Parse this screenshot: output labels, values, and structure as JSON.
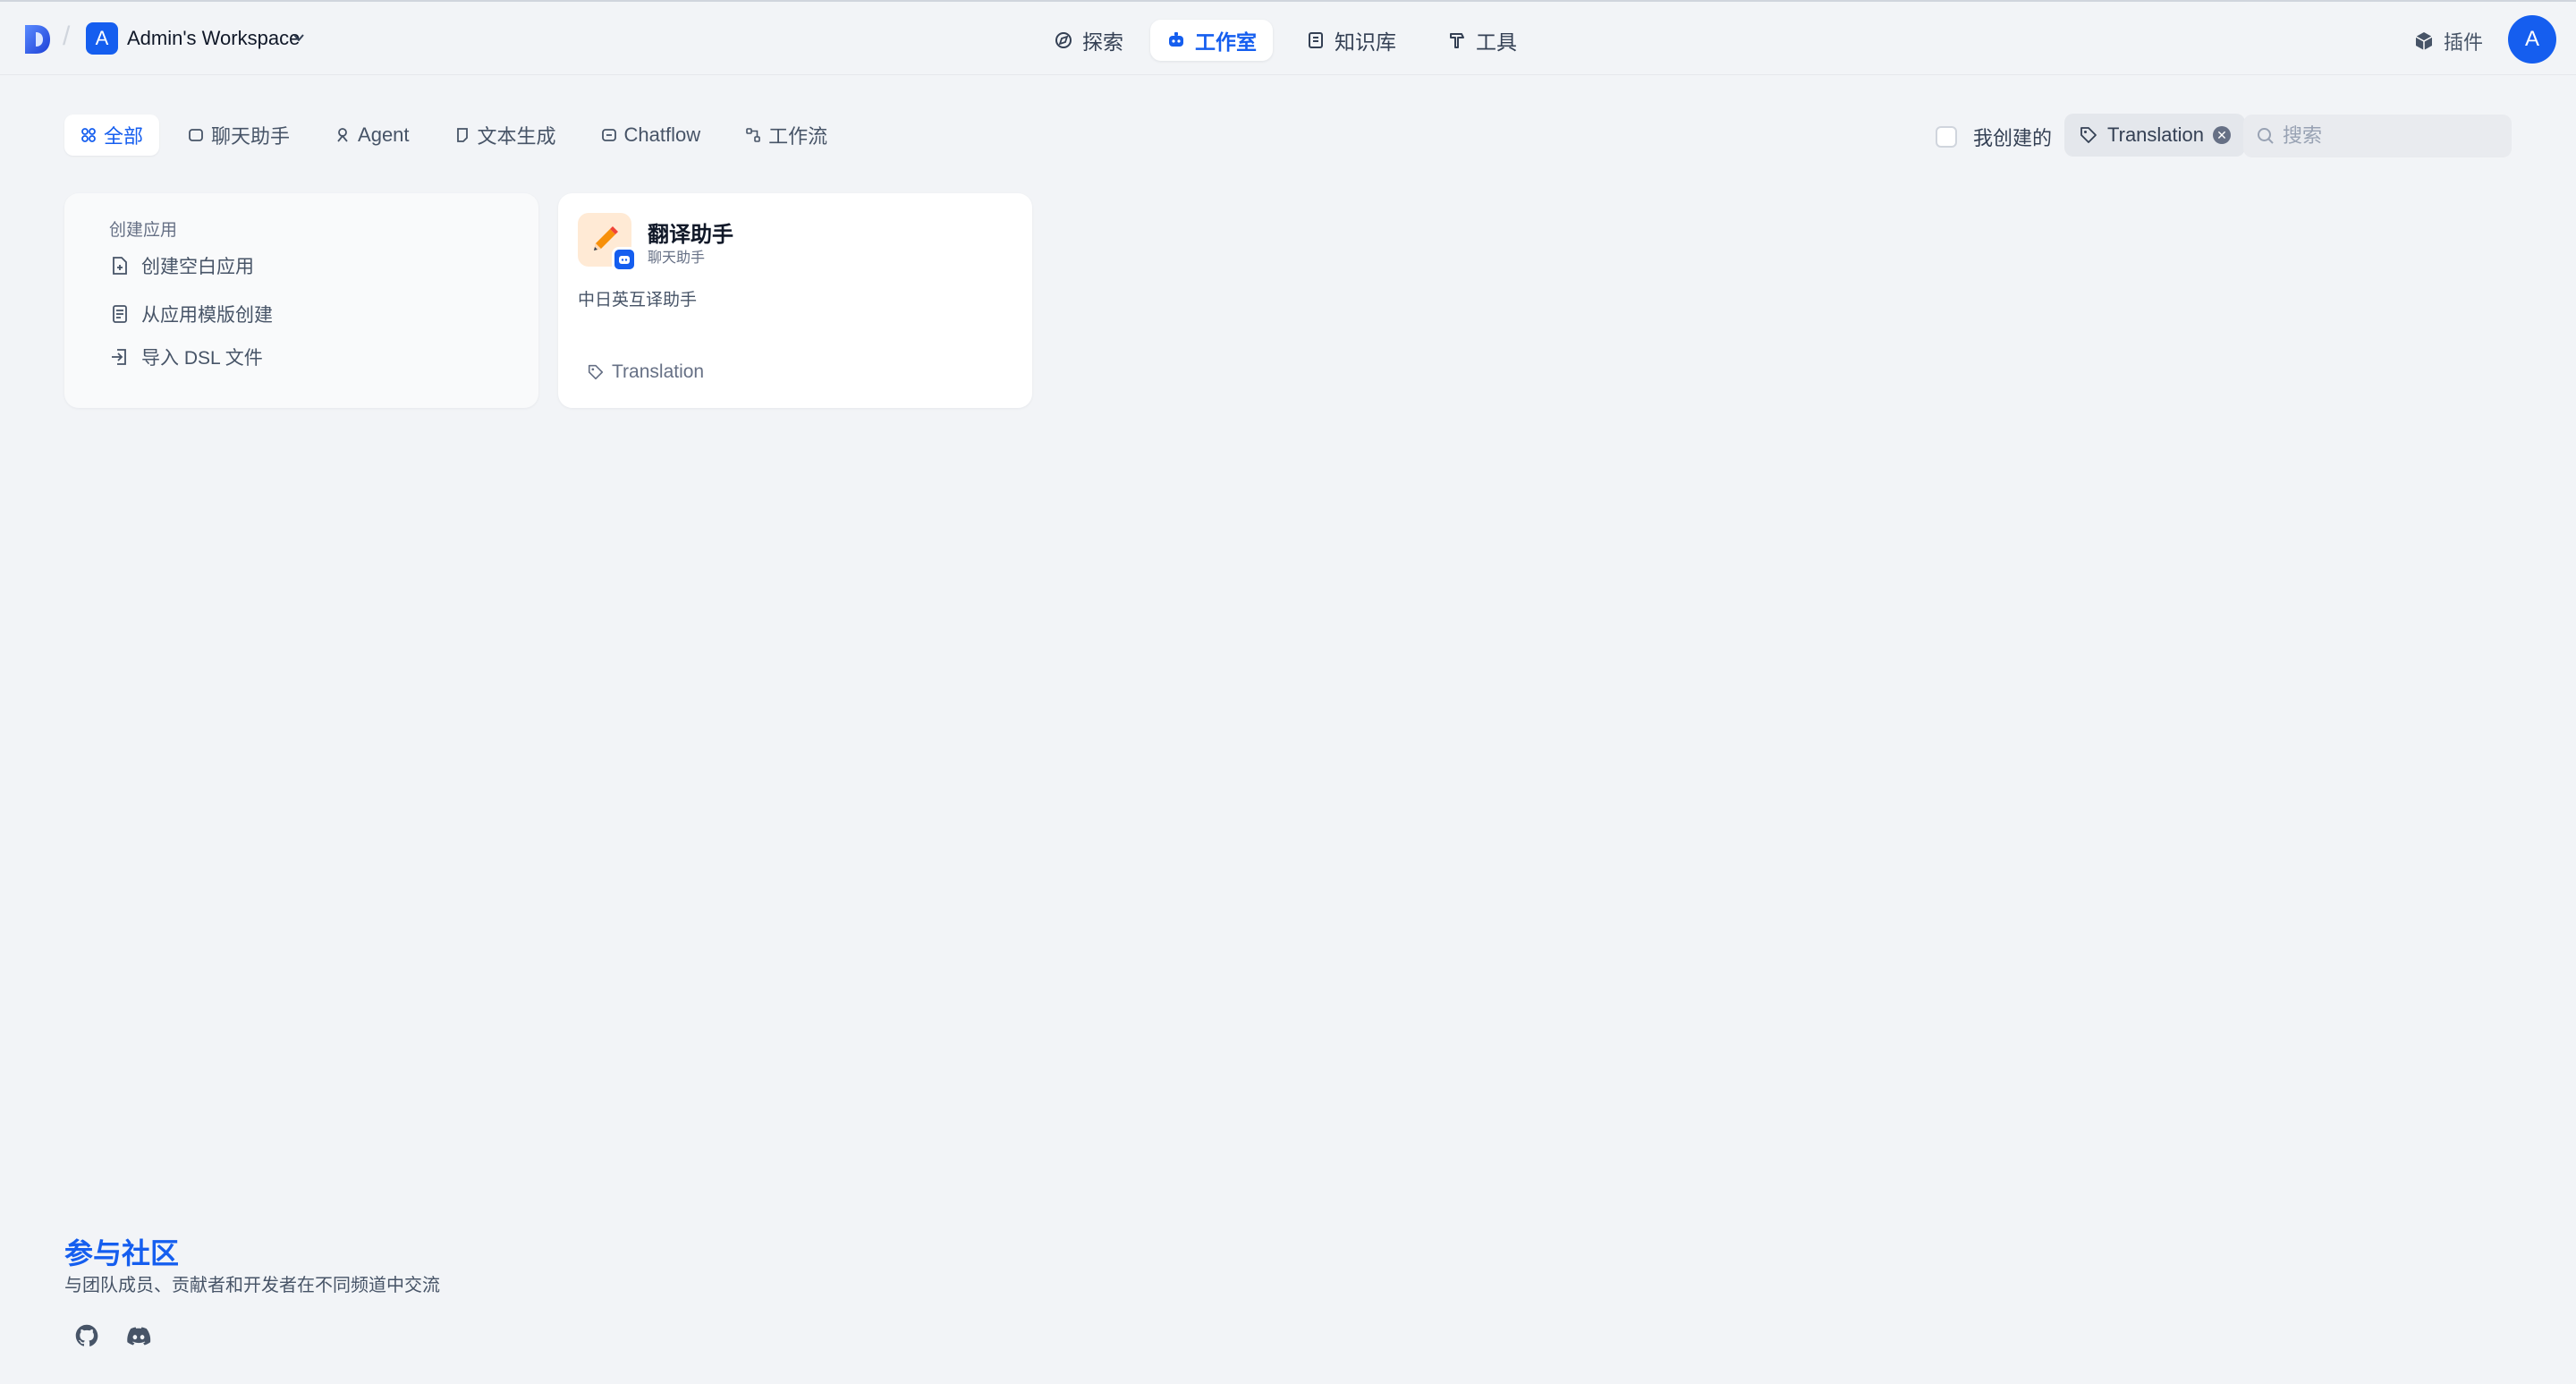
{
  "header": {
    "workspace_initial": "A",
    "workspace_name": "Admin's Workspace",
    "nav": [
      {
        "label": "探索",
        "icon": "compass-icon"
      },
      {
        "label": "工作室",
        "icon": "robot-icon"
      },
      {
        "label": "知识库",
        "icon": "book-icon"
      },
      {
        "label": "工具",
        "icon": "hammer-icon"
      }
    ],
    "active_nav": "工作室",
    "plugins_label": "插件",
    "user_initial": "A"
  },
  "tabs": [
    {
      "label": "全部",
      "icon": "grid-icon"
    },
    {
      "label": "聊天助手",
      "icon": "chat-icon"
    },
    {
      "label": "Agent",
      "icon": "agent-icon"
    },
    {
      "label": "文本生成",
      "icon": "document-icon"
    },
    {
      "label": "Chatflow",
      "icon": "chatflow-icon"
    },
    {
      "label": "工作流",
      "icon": "workflow-icon"
    }
  ],
  "active_tab": "全部",
  "filters": {
    "created_by_me_label": "我创建的",
    "created_by_me_checked": false,
    "tag_label": "Translation",
    "search_placeholder": "搜索",
    "search_value": ""
  },
  "create_card": {
    "title": "创建应用",
    "items": [
      {
        "label": "创建空白应用",
        "icon": "file-plus-icon"
      },
      {
        "label": "从应用模版创建",
        "icon": "template-icon"
      },
      {
        "label": "导入 DSL 文件",
        "icon": "import-icon"
      }
    ]
  },
  "apps": [
    {
      "name": "翻译助手",
      "type": "聊天助手",
      "description": "中日英互译助手",
      "tag": "Translation",
      "icon": "pencil-icon"
    }
  ],
  "community": {
    "title": "参与社区",
    "description": "与团队成员、贡献者和开发者在不同频道中交流",
    "links": [
      {
        "icon": "github-icon"
      },
      {
        "icon": "discord-icon"
      }
    ]
  },
  "colors": {
    "accent": "#155eef",
    "background": "#f2f4f7",
    "app_icon_bg": "#ffead5"
  }
}
